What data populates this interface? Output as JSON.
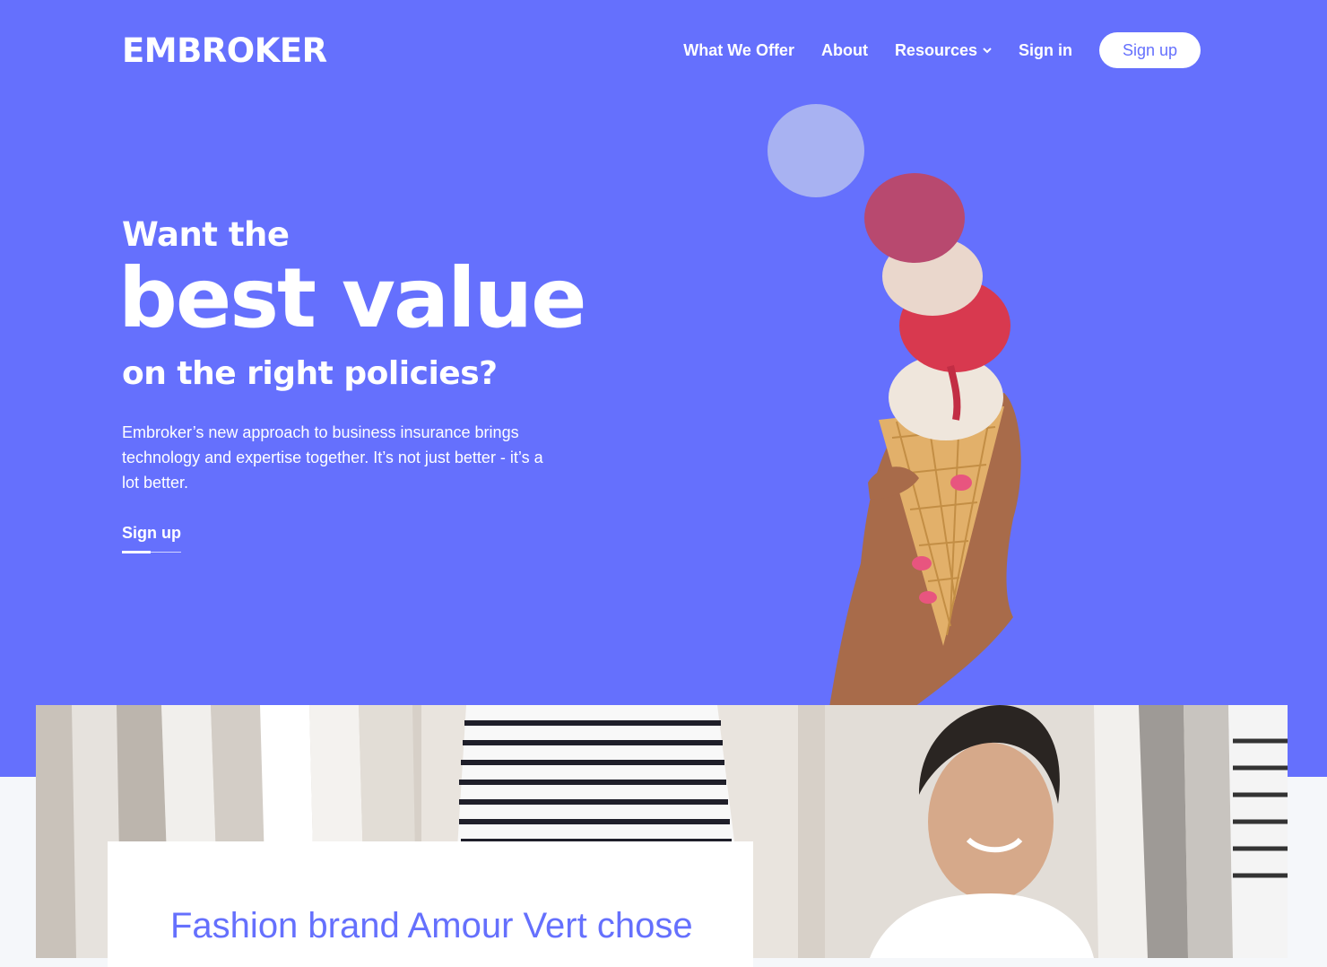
{
  "brand": {
    "logo_text": "EMBROKER",
    "accent": "#6570fd"
  },
  "nav": {
    "items": [
      "What We Offer",
      "About",
      "Resources",
      "Sign in"
    ],
    "resources_icon": "chevron-down-icon",
    "signup_label": "Sign up"
  },
  "hero": {
    "line1": "Want the",
    "line2": "best value",
    "line3": "on the right policies?",
    "body": "Embroker’s new approach to business insurance brings technology and expertise together. It’s not just better - it’s a lot better.",
    "cta": "Sign up"
  },
  "story": {
    "title": "Fashion brand Amour Vert chose"
  }
}
